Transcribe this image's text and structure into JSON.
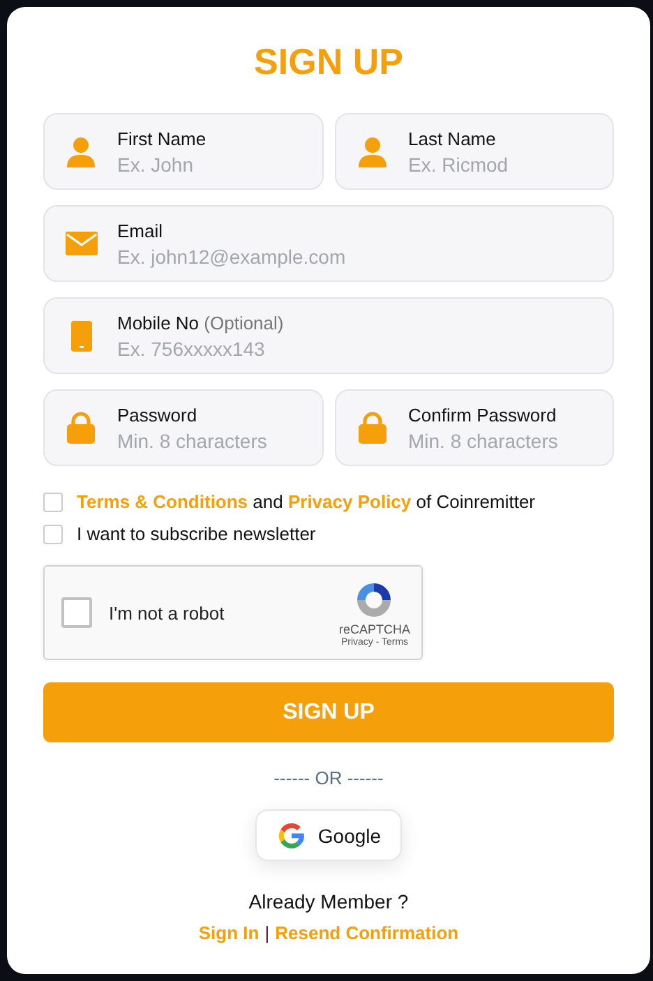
{
  "title": "SIGN UP",
  "field_rows": [
    [
      {
        "kind": "person",
        "label": "First Name",
        "placeholder": "Ex. John"
      },
      {
        "kind": "person",
        "label": "Last Name",
        "placeholder": "Ex. Ricmod"
      }
    ],
    [
      {
        "kind": "email",
        "label": "Email",
        "placeholder": "Ex. john12@example.com"
      }
    ],
    [
      {
        "kind": "phone",
        "label": "Mobile No",
        "note": "(Optional)",
        "placeholder": "Ex. 756xxxxx143"
      }
    ],
    [
      {
        "kind": "lock",
        "label": "Password",
        "placeholder": "Min. 8 characters"
      },
      {
        "kind": "lock",
        "label": "Confirm Password",
        "placeholder": "Min. 8 characters"
      }
    ]
  ],
  "checkboxes": [
    {
      "checked": false,
      "parts": [
        {
          "kind": "link",
          "text": "Terms & Conditions"
        },
        {
          "kind": "text",
          "text": " and "
        },
        {
          "kind": "link",
          "text": "Privacy Policy"
        },
        {
          "kind": "text",
          "text": " of Coinremitter"
        }
      ]
    },
    {
      "checked": false,
      "parts": [
        {
          "kind": "text",
          "text": "I want to subscribe newsletter"
        }
      ]
    }
  ],
  "captcha": {
    "checked": false,
    "label": "I'm not a robot",
    "brand": "reCAPTCHA",
    "links": "Privacy - Terms"
  },
  "submit": "SIGN UP",
  "divider": "------ OR ------",
  "google_button": "Google",
  "member_text": "Already Member ?",
  "footer_links": [
    {
      "text": "Sign In"
    },
    {
      "text": "Resend Confirmation"
    }
  ],
  "footer_separator": "|"
}
